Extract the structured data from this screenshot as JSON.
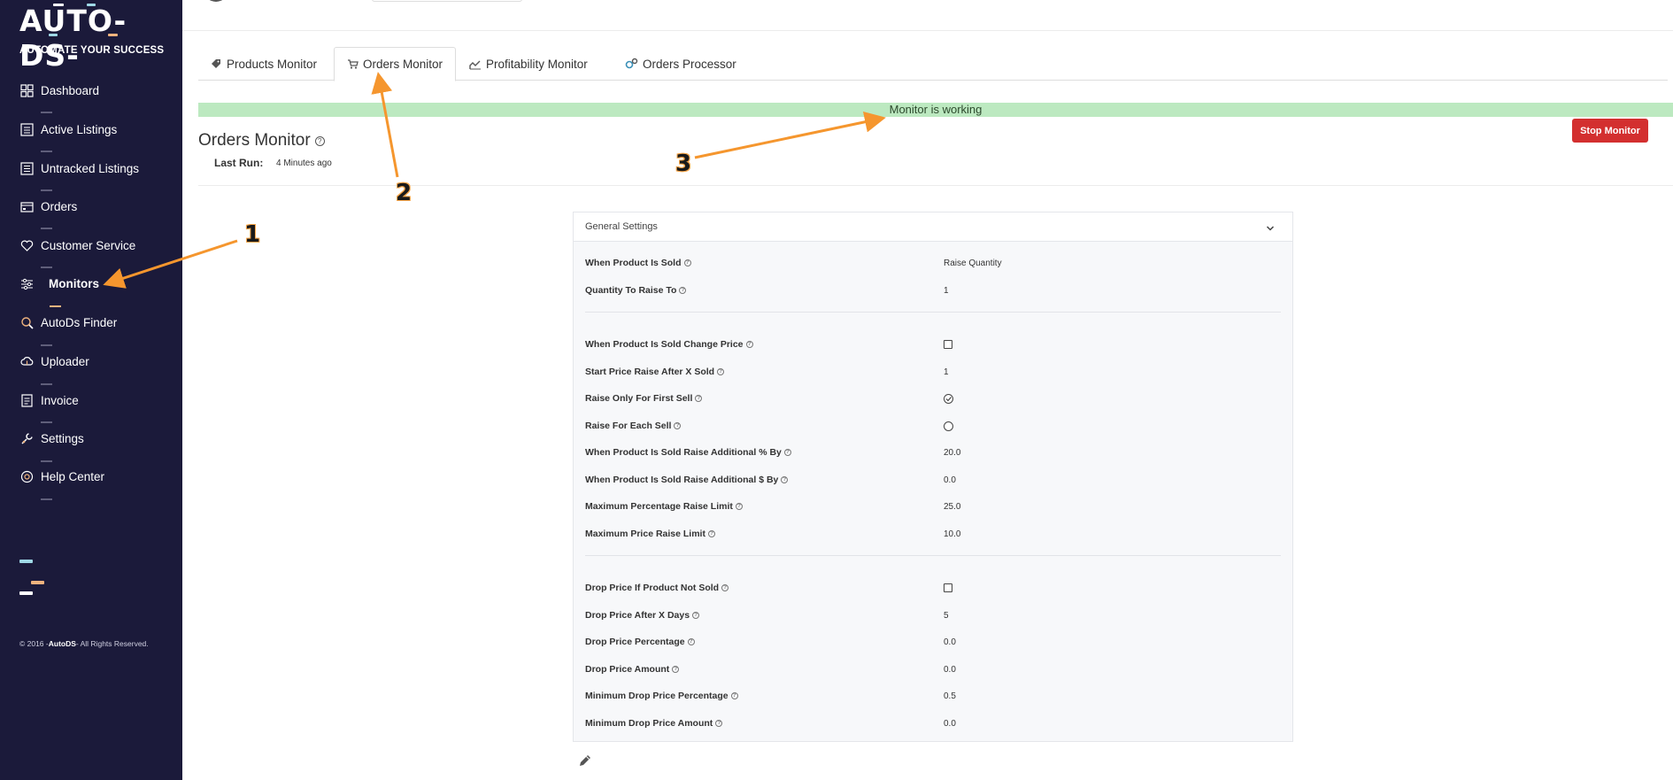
{
  "brand": {
    "logo_text": "AUTO-DS-",
    "tagline": "AUTOMATE YOUR SUCCESS",
    "copyright_prefix": "© 2016 -",
    "copyright_brand": "AutoDS",
    "copyright_suffix": "- All Rights Reserved."
  },
  "sidebar": {
    "items": [
      {
        "label": "Dashboard",
        "icon": "dashboard-icon"
      },
      {
        "label": "Active Listings",
        "icon": "list-icon"
      },
      {
        "label": "Untracked Listings",
        "icon": "list-icon"
      },
      {
        "label": "Orders",
        "icon": "orders-icon"
      },
      {
        "label": "Customer Service",
        "icon": "heart-icon"
      },
      {
        "label": "Monitors",
        "icon": "sliders-icon"
      },
      {
        "label": "AutoDs Finder",
        "icon": "search-icon"
      },
      {
        "label": "Uploader",
        "icon": "upload-cloud-icon"
      },
      {
        "label": "Invoice",
        "icon": "invoice-icon"
      },
      {
        "label": "Settings",
        "icon": "wrench-icon"
      },
      {
        "label": "Help Center",
        "icon": "lifebuoy-icon"
      }
    ]
  },
  "tabs": [
    {
      "label": "Products Monitor",
      "icon": "tag-icon"
    },
    {
      "label": "Orders Monitor",
      "icon": "cart-icon"
    },
    {
      "label": "Profitability Monitor",
      "icon": "chart-icon"
    },
    {
      "label": "Orders Processor",
      "icon": "gears-icon"
    }
  ],
  "status": {
    "text": "Monitor is working",
    "color": "#bce9c0"
  },
  "stop_button": {
    "label": "Stop Monitor",
    "color": "#d32f2f"
  },
  "page": {
    "title": "Orders Monitor",
    "last_run_label": "Last Run:",
    "last_run_value": "4 Minutes ago"
  },
  "settings": {
    "title": "General Settings",
    "rows": [
      {
        "label": "When Product Is Sold",
        "value": "Raise Quantity"
      },
      {
        "label": "Quantity To Raise To",
        "value": "1"
      },
      {
        "label": "When Product Is Sold Change Price",
        "control": "checkbox",
        "checked": false
      },
      {
        "label": "Start Price Raise After X Sold",
        "value": "1"
      },
      {
        "label": "Raise Only For First Sell",
        "control": "radio",
        "checked": true
      },
      {
        "label": "Raise For Each Sell",
        "control": "radio",
        "checked": false
      },
      {
        "label": "When Product Is Sold Raise Additional % By",
        "value": "20.0"
      },
      {
        "label": "When Product Is Sold Raise Additional $ By",
        "value": "0.0"
      },
      {
        "label": "Maximum Percentage Raise Limit",
        "value": "25.0"
      },
      {
        "label": "Maximum Price Raise Limit",
        "value": "10.0"
      },
      {
        "label": "Drop Price If Product Not Sold",
        "control": "checkbox",
        "checked": false
      },
      {
        "label": "Drop Price After X Days",
        "value": "5"
      },
      {
        "label": "Drop Price Percentage",
        "value": "0.0"
      },
      {
        "label": "Drop Price Amount",
        "value": "0.0"
      },
      {
        "label": "Minimum Drop Price Percentage",
        "value": "0.5"
      },
      {
        "label": "Minimum Drop Price Amount",
        "value": "0.0"
      }
    ]
  },
  "annotations": [
    "1",
    "2",
    "3"
  ],
  "colors": {
    "sidebar": "#1b1a3a",
    "accent": "#f5962e"
  }
}
